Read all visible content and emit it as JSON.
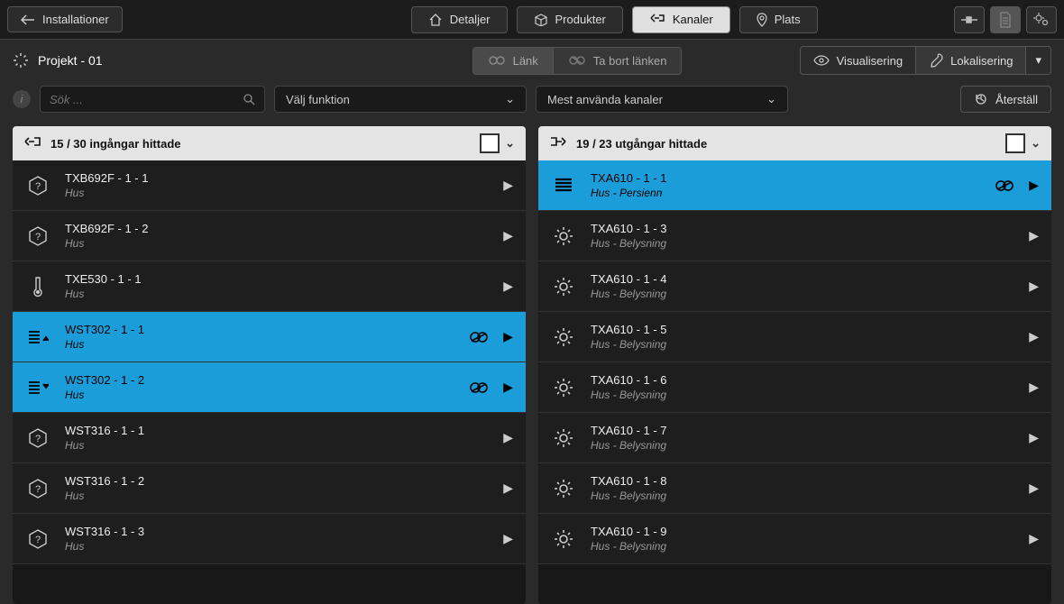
{
  "topbar": {
    "back_label": "Installationer",
    "tabs": [
      {
        "label": "Detaljer"
      },
      {
        "label": "Produkter"
      },
      {
        "label": "Kanaler"
      },
      {
        "label": "Plats"
      }
    ]
  },
  "project": {
    "name": "Projekt - 01"
  },
  "actions": {
    "link": "Länk",
    "unlink": "Ta bort länken",
    "visual": "Visualisering",
    "localize": "Lokalisering"
  },
  "filters": {
    "search_placeholder": "Sök ...",
    "function": "Välj funktion",
    "channels": "Mest använda kanaler",
    "reset": "Återställ"
  },
  "inputs": {
    "header": "15 / 30 ingångar hittade",
    "rows": [
      {
        "title": "TXB692F - 1 - 1",
        "sub": "Hus",
        "icon": "question",
        "selected": false,
        "badge": false
      },
      {
        "title": "TXB692F - 1 - 2",
        "sub": "Hus",
        "icon": "question",
        "selected": false,
        "badge": false
      },
      {
        "title": "TXE530 - 1 - 1",
        "sub": "Hus",
        "icon": "thermo",
        "selected": false,
        "badge": false
      },
      {
        "title": "WST302 - 1 - 1",
        "sub": "Hus",
        "icon": "blind-up",
        "selected": true,
        "badge": true
      },
      {
        "title": "WST302 - 1 - 2",
        "sub": "Hus",
        "icon": "blind-down",
        "selected": true,
        "badge": true
      },
      {
        "title": "WST316 - 1 - 1",
        "sub": "Hus",
        "icon": "question",
        "selected": false,
        "badge": false
      },
      {
        "title": "WST316 - 1 - 2",
        "sub": "Hus",
        "icon": "question",
        "selected": false,
        "badge": false
      },
      {
        "title": "WST316 - 1 - 3",
        "sub": "Hus",
        "icon": "question",
        "selected": false,
        "badge": false
      }
    ]
  },
  "outputs": {
    "header": "19 / 23 utgångar hittade",
    "rows": [
      {
        "title": "TXA610 - 1 - 1",
        "sub": "Hus - Persienn",
        "icon": "blind",
        "selected": true,
        "badge": true
      },
      {
        "title": "TXA610 - 1 - 3",
        "sub": "Hus - Belysning",
        "icon": "light",
        "selected": false,
        "badge": false
      },
      {
        "title": "TXA610 - 1 - 4",
        "sub": "Hus - Belysning",
        "icon": "light",
        "selected": false,
        "badge": false
      },
      {
        "title": "TXA610 - 1 - 5",
        "sub": "Hus - Belysning",
        "icon": "light",
        "selected": false,
        "badge": false
      },
      {
        "title": "TXA610 - 1 - 6",
        "sub": "Hus - Belysning",
        "icon": "light",
        "selected": false,
        "badge": false
      },
      {
        "title": "TXA610 - 1 - 7",
        "sub": "Hus - Belysning",
        "icon": "light",
        "selected": false,
        "badge": false
      },
      {
        "title": "TXA610 - 1 - 8",
        "sub": "Hus - Belysning",
        "icon": "light",
        "selected": false,
        "badge": false
      },
      {
        "title": "TXA610 - 1 - 9",
        "sub": "Hus - Belysning",
        "icon": "light",
        "selected": false,
        "badge": false
      }
    ]
  },
  "icons": {
    "question": "question-icon",
    "thermo": "thermometer-icon",
    "blind-up": "blind-up-icon",
    "blind-down": "blind-down-icon",
    "blind": "blind-icon",
    "light": "light-icon"
  }
}
